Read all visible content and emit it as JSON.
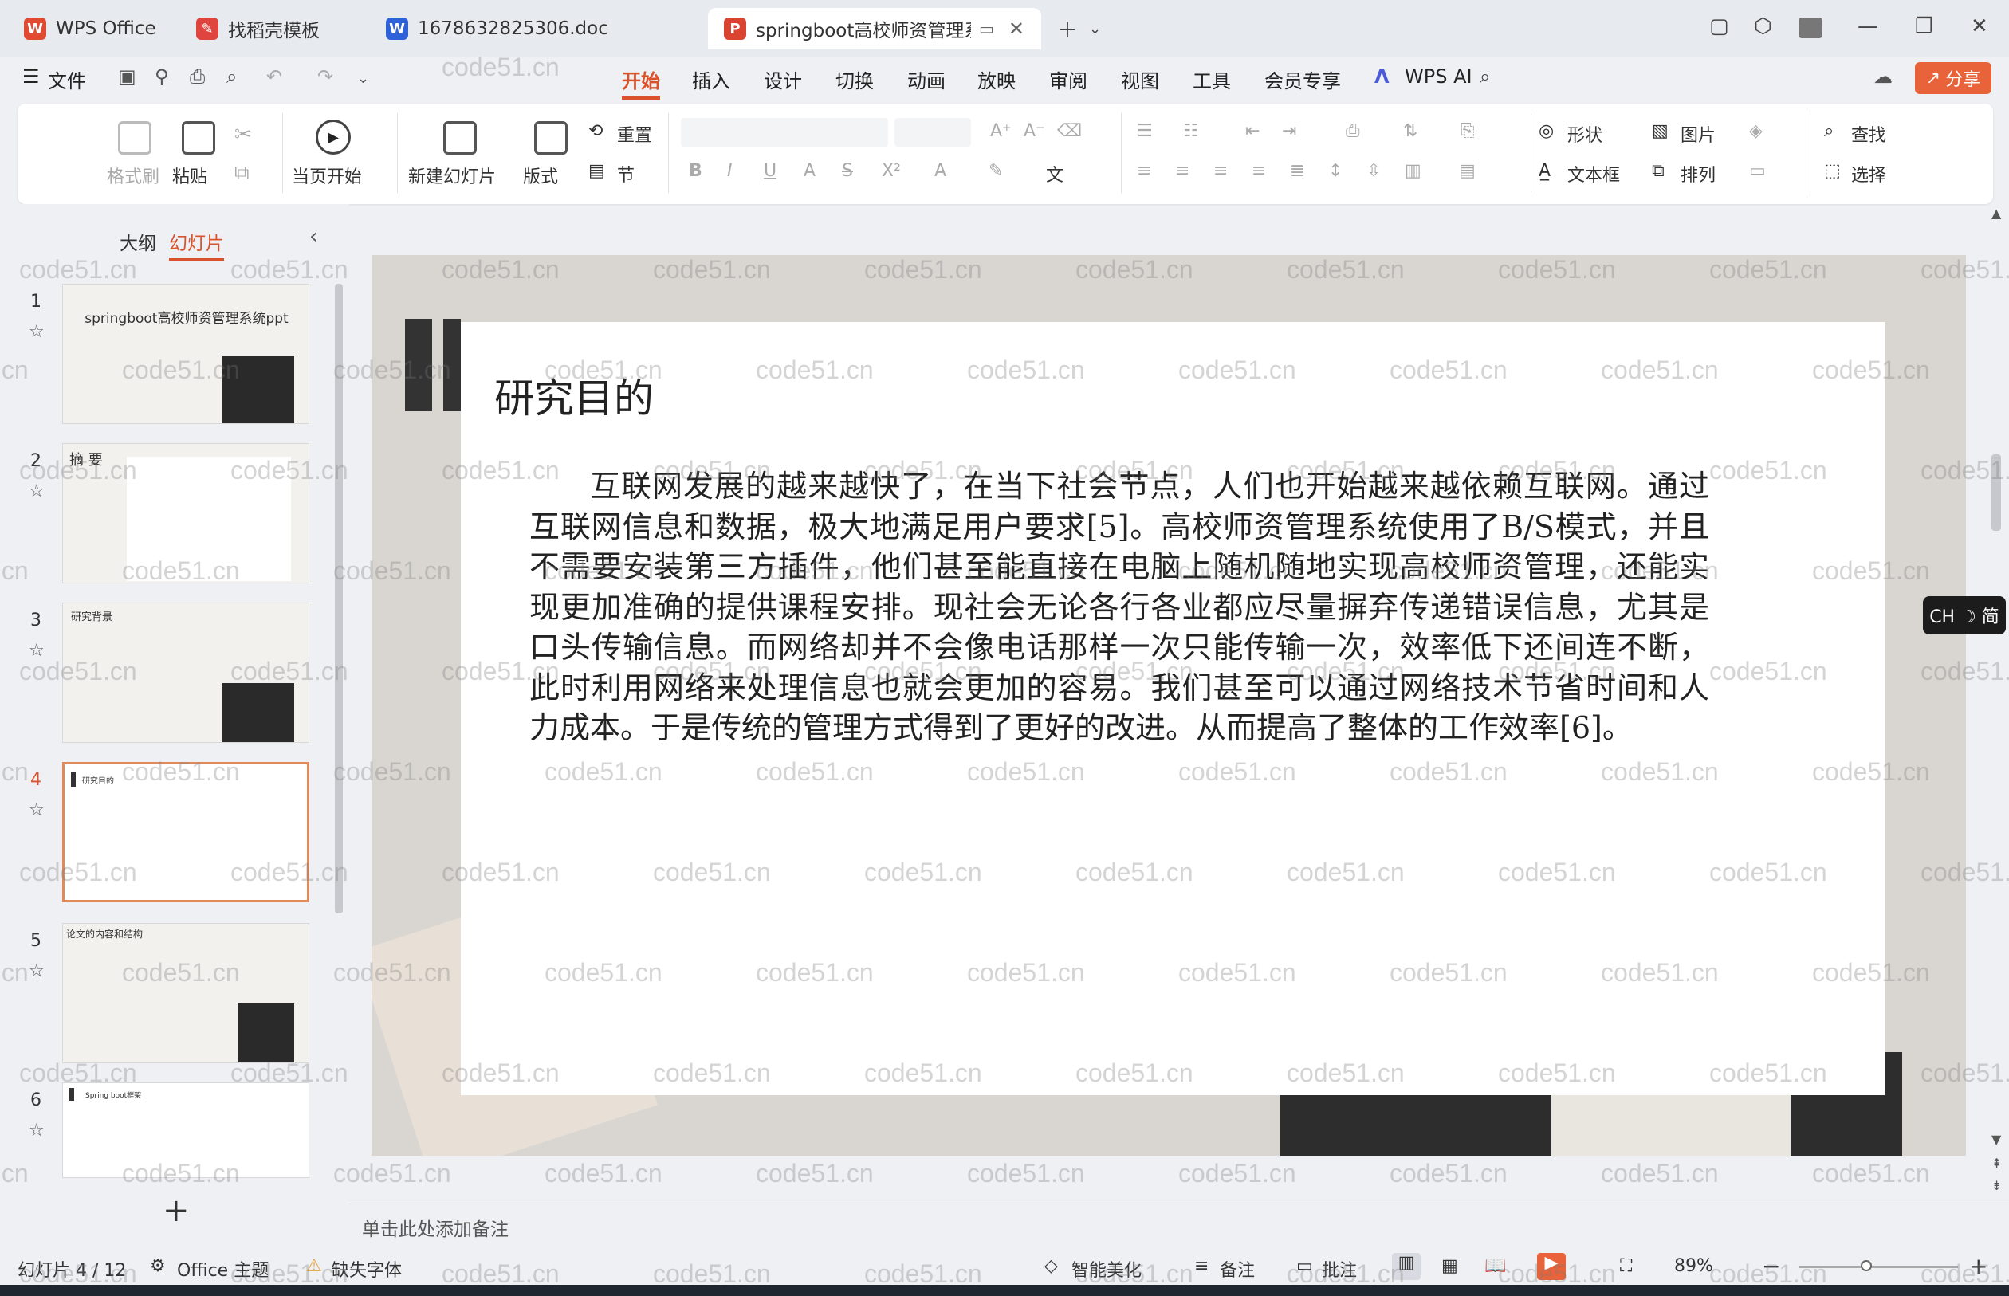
{
  "tabs": [
    {
      "label": "WPS Office",
      "icon": "wps-logo-icon",
      "color": "#e04a32"
    },
    {
      "label": "找稻壳模板",
      "icon": "docer-icon",
      "color": "#e0443e"
    },
    {
      "label": "1678632825306.doc",
      "icon": "word-doc-icon",
      "color": "#2f62d8"
    },
    {
      "label": "springboot高校师资管理系统",
      "icon": "ppt-icon",
      "color": "#d9432f"
    }
  ],
  "menu": {
    "file": "文件",
    "items": [
      "开始",
      "插入",
      "设计",
      "切换",
      "动画",
      "放映",
      "审阅",
      "视图",
      "工具",
      "会员专享"
    ],
    "wps_ai": "WPS AI",
    "share": "分享"
  },
  "ribbon": {
    "format_brush": "格式刷",
    "paste": "粘贴",
    "play_from_current": "当页开始",
    "new_slide": "新建幻灯片",
    "layout": "版式",
    "reset": "重置",
    "section": "节",
    "shape": "形状",
    "picture": "图片",
    "find": "查找",
    "textbox": "文本框",
    "arrange": "排列",
    "select": "选择"
  },
  "panel": {
    "outline_tab": "大纲",
    "slides_tab": "幻灯片",
    "thumbnails": [
      {
        "num": "1",
        "text": "springboot高校师资管理系统ppt"
      },
      {
        "num": "2",
        "text": "摘 要"
      },
      {
        "num": "3",
        "text": "研究背景"
      },
      {
        "num": "4",
        "text": "研究目的"
      },
      {
        "num": "5",
        "text": "论文的内容和结构"
      },
      {
        "num": "6",
        "text": "Spring boot框架"
      }
    ],
    "add_slide": "+"
  },
  "slide": {
    "title": "研究目的",
    "body": "互联网发展的越来越快了，在当下社会节点，人们也开始越来越依赖互联网。通过互联网信息和数据，极大地满足用户要求[5]。高校师资管理系统使用了B/S模式，并且不需要安装第三方插件，他们甚至能直接在电脑上随机随地实现高校师资管理，还能实现更加准确的提供课程安排。现社会无论各行各业都应尽量摒弃传递错误信息，尤其是口头传输信息。而网络却并不会像电话那样一次只能传输一次，效率低下还间连不断，此时利用网络来处理信息也就会更加的容易。我们甚至可以通过网络技术节省时间和人力成本。于是传统的管理方式得到了更好的改进。从而提高了整体的工作效率[6]。"
  },
  "notes_placeholder": "单击此处添加备注",
  "status": {
    "slide_counter": "幻灯片 4 / 12",
    "theme": "Office 主题",
    "missing_font": "缺失字体",
    "smart_beautify": "智能美化",
    "notes": "备注",
    "comments": "批注",
    "zoom": "89%"
  },
  "ime": "CH ☽ 简",
  "watermark": "code51.cn"
}
